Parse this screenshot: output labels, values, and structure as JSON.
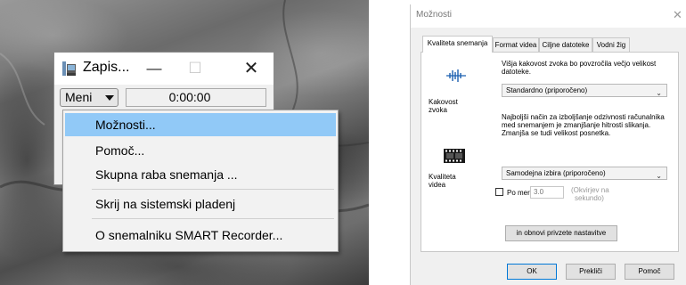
{
  "recorder_window": {
    "title": "Zapis...",
    "minimize_glyph": "—",
    "maximize_glyph": "☐",
    "close_glyph": "✕",
    "menu_button_label": "Meni",
    "time_display": "0:00:00",
    "app_icon": "recorder-app-icon"
  },
  "context_menu": {
    "items": [
      {
        "label": "Možnosti...",
        "highlighted": true
      },
      {
        "label": "Pomoč..."
      },
      {
        "label": "Skupna raba snemanja ..."
      },
      {
        "label": "Skrij na sistemski pladenj"
      },
      {
        "label": "O snemalniku SMART Recorder..."
      }
    ],
    "highlight_color": "#91c9f7"
  },
  "options_dialog": {
    "title": "Možnosti",
    "close_glyph": "✕",
    "tabs": [
      {
        "label": "Kvaliteta snemanja",
        "active": true
      },
      {
        "label": "Format videa"
      },
      {
        "label": "Ciljne datoteke"
      },
      {
        "label": "Vodni žig"
      }
    ],
    "audio": {
      "icon": "audio-wave-icon",
      "label_line1": "Kakovost",
      "label_line2": "zvoka",
      "description": "Višja kakovost zvoka bo povzročila večjo velikost datoteke.",
      "selected": "Standardno (priporočeno)"
    },
    "video": {
      "icon": "film-strip-icon",
      "label_line1": "Kvaliteta",
      "label_line2": "videa",
      "description": "Najboljši način za izboljšanje odzivnosti računalnika med snemanjem je zmanjšanje hitrosti slikanja. Zmanjša se tudi velikost posnetka.",
      "selected": "Samodejna izbira (priporočeno)",
      "checkbox_label": "Po meri:",
      "checkbox_checked": false,
      "fps_value": "3.0",
      "fps_unit_line1": "(Okvirjev na",
      "fps_unit_line2": "sekundo)"
    },
    "reset_button": "in obnovi privzete nastavitve",
    "buttons": {
      "ok": "OK",
      "cancel": "Prekliči",
      "help": "Pomoč"
    },
    "accent_color": "#0078d7"
  }
}
